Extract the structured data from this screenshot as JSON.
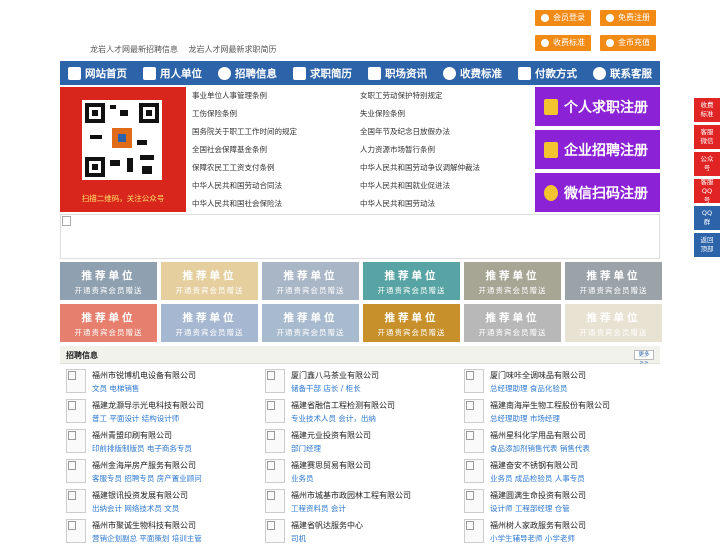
{
  "top_buttons": {
    "member_login": "会员登录",
    "free_register": "免费注册",
    "fee_standard": "收费标准",
    "coin_recharge": "金币充值"
  },
  "sub_links": [
    "龙岩人才网最新招聘信息",
    "龙岩人才网最新求职简历"
  ],
  "nav": [
    "网站首页",
    "用人单位",
    "招聘信息",
    "求职简历",
    "职场资讯",
    "收费标准",
    "付款方式",
    "联系客服"
  ],
  "qr_caption": "扫描二维码，关注公众号",
  "rules": [
    [
      "事业单位人事管理条例",
      "女职工劳动保护特别规定"
    ],
    [
      "工伤保险条例",
      "失业保险条例"
    ],
    [
      "国务院关于职工工作时间的规定",
      "全国年节及纪念日放假办法"
    ],
    [
      "全国社会保障基金条例",
      "人力资源市场暂行条例"
    ],
    [
      "保障农民工工资支付条例",
      "中华人民共和国劳动争议调解仲裁法"
    ],
    [
      "中华人民共和国劳动合同法",
      "中华人民共和国就业促进法"
    ],
    [
      "中华人民共和国社会保险法",
      "中华人民共和国劳动法"
    ]
  ],
  "register": {
    "personal": "个人求职注册",
    "company": "企业招聘注册",
    "wechat": "微信扫码注册"
  },
  "ad": {
    "title": "推荐单位",
    "subtitle": "开通贵宾会员赠送",
    "colors": [
      "#8fa1b0",
      "#e6cf9f",
      "#a9b6c6",
      "#58a3a3",
      "#a7a594",
      "#9ba2a8",
      "#e67f6d",
      "#a6b7d1",
      "#a8bbce",
      "#c7902a",
      "#b8b8b8",
      "#e8e2d2"
    ]
  },
  "jobs_section": {
    "title": "招聘信息",
    "more": "更多>>"
  },
  "jobs": [
    {
      "company": "福州市锐博机电设备有限公司",
      "positions": "文员 电梯销售"
    },
    {
      "company": "厦门鑫八马茶业有限公司",
      "positions": "储备干部 店长 / 柜长"
    },
    {
      "company": "厦门味咔全调味品有限公司",
      "positions": "总经理助理 食品化验员"
    },
    {
      "company": "福建龙灏导示光电科技有限公司",
      "positions": "普工 平面设计 结构设计师"
    },
    {
      "company": "福建省融信工程检测有限公司",
      "positions": "专业技术人员 会计，出纳"
    },
    {
      "company": "福建南海岸生物工程股份有限公司",
      "positions": "总经理助理 市场经理"
    },
    {
      "company": "福州青盟印刷有限公司",
      "positions": "印前排版制版员 电子商务专员"
    },
    {
      "company": "福建元业投资有限公司",
      "positions": "部门经理"
    },
    {
      "company": "福州星科化学用品有限公司",
      "positions": "食品添加剂销售代表 销售代表"
    },
    {
      "company": "福州金海岸房产服务有限公司",
      "positions": "客服专员 招聘专员 房产置业顾问"
    },
    {
      "company": "福建赛思贸易有限公司",
      "positions": "业务员"
    },
    {
      "company": "福建奋安不锈钢有限公司",
      "positions": "业务员 成品检验员 人事专员"
    },
    {
      "company": "福建银讯投资发展有限公司",
      "positions": "出纳会计 网络技术员 文员"
    },
    {
      "company": "福州市城基市政园林工程有限公司",
      "positions": "工程资料员 会计"
    },
    {
      "company": "福建圆满生命投资有限公司",
      "positions": "设计师 工程部经理 仓管"
    },
    {
      "company": "福州市聚诚生物科技有限公司",
      "positions": "营销企划副总 平面策划 培训主管"
    },
    {
      "company": "福建省帆达服务中心",
      "positions": "司机"
    },
    {
      "company": "福州树人家政服务有限公司",
      "positions": "小学生辅导老师 小学老师"
    }
  ],
  "sidebar": [
    "收费标准",
    "客服微信",
    "公众号",
    "客服QQ号",
    "QQ群",
    "返回顶部"
  ]
}
